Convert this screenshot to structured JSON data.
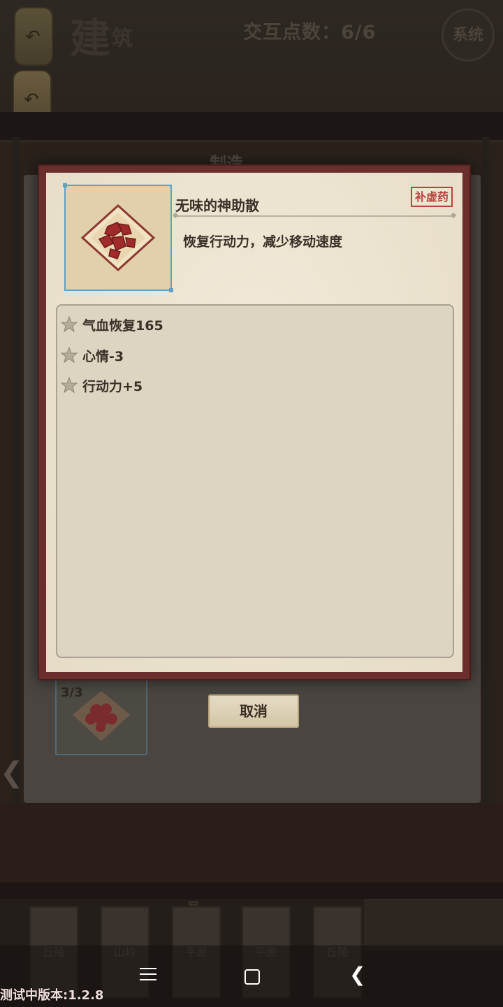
{
  "hud": {
    "title_main": "建",
    "title_sub": "筑",
    "interaction_points": "交互点数：6/6",
    "system_button": "系统"
  },
  "crafting_panel": {
    "header": "制造",
    "slot_count": "3/3",
    "cancel_label": "取消"
  },
  "map_tiles": {
    "section_label": "局",
    "tiles": [
      "丘陵",
      "山岭",
      "平原",
      "平原",
      "丘陵"
    ]
  },
  "item": {
    "name": "无味的神助散",
    "tag": "补虚药",
    "description": "恢复行动力，减少移动速度",
    "effects": [
      "气血恢复165",
      "心情-3",
      "行动力+5"
    ]
  },
  "footer": {
    "version": "测试中版本:1.2.8"
  },
  "colors": {
    "modal_border": "#6a2e2c",
    "tag_red": "#b8423c",
    "icon_frame_blue": "#5fa1c8"
  }
}
